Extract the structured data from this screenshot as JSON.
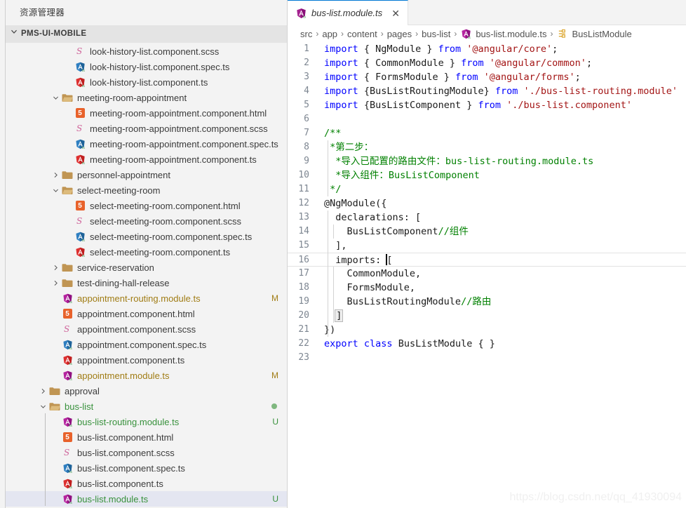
{
  "sidebar": {
    "title": "资源管理器",
    "project": {
      "name": "PMS-UI-MOBILE",
      "expanded": true
    },
    "tree": [
      {
        "depth": 4,
        "type": "file",
        "icon": "sass-icon",
        "label": "look-history-list.component.scss",
        "badge": "",
        "state": ""
      },
      {
        "depth": 4,
        "type": "file",
        "icon": "angular-spec-icon",
        "label": "look-history-list.component.spec.ts",
        "badge": "",
        "state": ""
      },
      {
        "depth": 4,
        "type": "file",
        "icon": "angular-ts-icon",
        "label": "look-history-list.component.ts",
        "badge": "",
        "state": ""
      },
      {
        "depth": 3,
        "type": "folder",
        "expanded": true,
        "icon": "folder-open-icon",
        "label": "meeting-room-appointment",
        "badge": "",
        "state": ""
      },
      {
        "depth": 4,
        "type": "file",
        "icon": "html5-icon",
        "label": "meeting-room-appointment.component.html",
        "badge": "",
        "state": ""
      },
      {
        "depth": 4,
        "type": "file",
        "icon": "sass-icon",
        "label": "meeting-room-appointment.component.scss",
        "badge": "",
        "state": ""
      },
      {
        "depth": 4,
        "type": "file",
        "icon": "angular-spec-icon",
        "label": "meeting-room-appointment.component.spec.ts",
        "badge": "",
        "state": ""
      },
      {
        "depth": 4,
        "type": "file",
        "icon": "angular-ts-icon",
        "label": "meeting-room-appointment.component.ts",
        "badge": "",
        "state": ""
      },
      {
        "depth": 3,
        "type": "folder",
        "expanded": false,
        "icon": "folder-icon",
        "label": "personnel-appointment",
        "badge": "",
        "state": ""
      },
      {
        "depth": 3,
        "type": "folder",
        "expanded": true,
        "icon": "folder-open-icon",
        "label": "select-meeting-room",
        "badge": "",
        "state": ""
      },
      {
        "depth": 4,
        "type": "file",
        "icon": "html5-icon",
        "label": "select-meeting-room.component.html",
        "badge": "",
        "state": ""
      },
      {
        "depth": 4,
        "type": "file",
        "icon": "sass-icon",
        "label": "select-meeting-room.component.scss",
        "badge": "",
        "state": ""
      },
      {
        "depth": 4,
        "type": "file",
        "icon": "angular-spec-icon",
        "label": "select-meeting-room.component.spec.ts",
        "badge": "",
        "state": ""
      },
      {
        "depth": 4,
        "type": "file",
        "icon": "angular-ts-icon",
        "label": "select-meeting-room.component.ts",
        "badge": "",
        "state": ""
      },
      {
        "depth": 3,
        "type": "folder",
        "expanded": false,
        "icon": "folder-icon",
        "label": "service-reservation",
        "badge": "",
        "state": ""
      },
      {
        "depth": 3,
        "type": "folder",
        "expanded": false,
        "icon": "folder-icon",
        "label": "test-dining-hall-release",
        "badge": "",
        "state": ""
      },
      {
        "depth": 3,
        "type": "file",
        "icon": "angular-module-icon",
        "label": "appointment-routing.module.ts",
        "badge": "M",
        "state": "mod"
      },
      {
        "depth": 3,
        "type": "file",
        "icon": "html5-icon",
        "label": "appointment.component.html",
        "badge": "",
        "state": ""
      },
      {
        "depth": 3,
        "type": "file",
        "icon": "sass-icon",
        "label": "appointment.component.scss",
        "badge": "",
        "state": ""
      },
      {
        "depth": 3,
        "type": "file",
        "icon": "angular-spec-icon",
        "label": "appointment.component.spec.ts",
        "badge": "",
        "state": ""
      },
      {
        "depth": 3,
        "type": "file",
        "icon": "angular-ts-icon",
        "label": "appointment.component.ts",
        "badge": "",
        "state": ""
      },
      {
        "depth": 3,
        "type": "file",
        "icon": "angular-module-icon",
        "label": "appointment.module.ts",
        "badge": "M",
        "state": "mod"
      },
      {
        "depth": 2,
        "type": "folder",
        "expanded": false,
        "icon": "folder-icon",
        "label": "approval",
        "badge": "",
        "state": ""
      },
      {
        "depth": 2,
        "type": "folder",
        "expanded": true,
        "icon": "folder-open-icon",
        "label": "bus-list",
        "badge": "dot",
        "state": "untracked"
      },
      {
        "depth": 3,
        "type": "file",
        "icon": "angular-module-icon",
        "label": "bus-list-routing.module.ts",
        "badge": "U",
        "state": "untracked"
      },
      {
        "depth": 3,
        "type": "file",
        "icon": "html5-icon",
        "label": "bus-list.component.html",
        "badge": "",
        "state": ""
      },
      {
        "depth": 3,
        "type": "file",
        "icon": "sass-icon",
        "label": "bus-list.component.scss",
        "badge": "",
        "state": ""
      },
      {
        "depth": 3,
        "type": "file",
        "icon": "angular-spec-icon",
        "label": "bus-list.component.spec.ts",
        "badge": "",
        "state": ""
      },
      {
        "depth": 3,
        "type": "file",
        "icon": "angular-ts-icon",
        "label": "bus-list.component.ts",
        "badge": "",
        "state": ""
      },
      {
        "depth": 3,
        "type": "file",
        "icon": "angular-module-icon",
        "label": "bus-list.module.ts",
        "badge": "U",
        "state": "untracked",
        "selected": true
      }
    ]
  },
  "editor": {
    "tab": {
      "label": "bus-list.module.ts",
      "icon": "angular-module-icon",
      "close": "✕",
      "active": true
    },
    "breadcrumb": [
      {
        "label": "src",
        "icon": ""
      },
      {
        "label": "app",
        "icon": ""
      },
      {
        "label": "content",
        "icon": ""
      },
      {
        "label": "pages",
        "icon": ""
      },
      {
        "label": "bus-list",
        "icon": ""
      },
      {
        "label": "bus-list.module.ts",
        "icon": "angular-module-icon"
      },
      {
        "label": "BusListModule",
        "icon": "class-symbol-icon"
      }
    ],
    "breadcrumb_separator": "›",
    "lines": [
      {
        "n": "1",
        "segments": [
          {
            "t": "kw",
            "v": "import"
          },
          {
            "t": "punc",
            "v": " { "
          },
          {
            "t": "ident",
            "v": "NgModule"
          },
          {
            "t": "punc",
            "v": " } "
          },
          {
            "t": "kw",
            "v": "from"
          },
          {
            "t": "punc",
            "v": " "
          },
          {
            "t": "str",
            "v": "'@angular/core'"
          },
          {
            "t": "punc",
            "v": ";"
          }
        ]
      },
      {
        "n": "2",
        "segments": [
          {
            "t": "kw",
            "v": "import"
          },
          {
            "t": "punc",
            "v": " { "
          },
          {
            "t": "ident",
            "v": "CommonModule"
          },
          {
            "t": "punc",
            "v": " } "
          },
          {
            "t": "kw",
            "v": "from"
          },
          {
            "t": "punc",
            "v": " "
          },
          {
            "t": "str",
            "v": "'@angular/common'"
          },
          {
            "t": "punc",
            "v": ";"
          }
        ]
      },
      {
        "n": "3",
        "segments": [
          {
            "t": "kw",
            "v": "import"
          },
          {
            "t": "punc",
            "v": " { "
          },
          {
            "t": "ident",
            "v": "FormsModule"
          },
          {
            "t": "punc",
            "v": " } "
          },
          {
            "t": "kw",
            "v": "from"
          },
          {
            "t": "punc",
            "v": " "
          },
          {
            "t": "str",
            "v": "'@angular/forms'"
          },
          {
            "t": "punc",
            "v": ";"
          }
        ]
      },
      {
        "n": "4",
        "segments": [
          {
            "t": "kw",
            "v": "import"
          },
          {
            "t": "punc",
            "v": " {"
          },
          {
            "t": "ident",
            "v": "BusListRoutingModule"
          },
          {
            "t": "punc",
            "v": "} "
          },
          {
            "t": "kw",
            "v": "from"
          },
          {
            "t": "punc",
            "v": " "
          },
          {
            "t": "str",
            "v": "'./bus-list-routing.module'"
          }
        ]
      },
      {
        "n": "5",
        "segments": [
          {
            "t": "kw",
            "v": "import"
          },
          {
            "t": "punc",
            "v": " {"
          },
          {
            "t": "ident",
            "v": "BusListComponent"
          },
          {
            "t": "punc",
            "v": " } "
          },
          {
            "t": "kw",
            "v": "from"
          },
          {
            "t": "punc",
            "v": " "
          },
          {
            "t": "str",
            "v": "'./bus-list.component'"
          }
        ]
      },
      {
        "n": "6",
        "segments": []
      },
      {
        "n": "7",
        "segments": [
          {
            "t": "cmt",
            "v": "/**"
          }
        ]
      },
      {
        "n": "8",
        "segments": [
          {
            "t": "cmt",
            "v": " *第二步："
          }
        ]
      },
      {
        "n": "9",
        "segments": [
          {
            "t": "cmt",
            "v": "  *导入已配置的路由文件：bus-list-routing.module.ts"
          }
        ]
      },
      {
        "n": "10",
        "segments": [
          {
            "t": "cmt",
            "v": "  *导入组件：BusListComponent"
          }
        ]
      },
      {
        "n": "11",
        "segments": [
          {
            "t": "cmt",
            "v": " */"
          }
        ]
      },
      {
        "n": "12",
        "segments": [
          {
            "t": "deco",
            "v": "@NgModule({"
          }
        ]
      },
      {
        "n": "13",
        "segments": [
          {
            "t": "plain",
            "v": "  declarations: ["
          }
        ]
      },
      {
        "n": "14",
        "segments": [
          {
            "t": "plain",
            "v": "    BusListComponent"
          },
          {
            "t": "cmt",
            "v": "//组件"
          }
        ]
      },
      {
        "n": "15",
        "segments": [
          {
            "t": "plain",
            "v": "  ],"
          }
        ]
      },
      {
        "n": "16",
        "segments": [
          {
            "t": "plain",
            "v": "  imports: "
          },
          {
            "t": "cursor",
            "v": "["
          }
        ],
        "current": true
      },
      {
        "n": "17",
        "segments": [
          {
            "t": "plain",
            "v": "    CommonModule,"
          }
        ]
      },
      {
        "n": "18",
        "segments": [
          {
            "t": "plain",
            "v": "    FormsModule,"
          }
        ]
      },
      {
        "n": "19",
        "segments": [
          {
            "t": "plain",
            "v": "    BusListRoutingModule"
          },
          {
            "t": "cmt",
            "v": "//路由"
          }
        ]
      },
      {
        "n": "20",
        "segments": [
          {
            "t": "plain",
            "v": "  "
          },
          {
            "t": "bracket",
            "v": "]"
          }
        ]
      },
      {
        "n": "21",
        "segments": [
          {
            "t": "plain",
            "v": "})"
          }
        ]
      },
      {
        "n": "22",
        "segments": [
          {
            "t": "kw",
            "v": "export"
          },
          {
            "t": "punc",
            "v": " "
          },
          {
            "t": "kw",
            "v": "class"
          },
          {
            "t": "punc",
            "v": " "
          },
          {
            "t": "ident",
            "v": "BusListModule"
          },
          {
            "t": "punc",
            "v": " { }"
          }
        ]
      },
      {
        "n": "23",
        "segments": []
      }
    ]
  },
  "watermark": "https://blog.csdn.net/qq_41930094",
  "colors": {
    "accent": "#0078d4",
    "modified": "#a07c14",
    "untracked": "#38913c",
    "selection": "#e4e6f1",
    "sidebar_bg": "#f3f3f3",
    "keyword": "#0000ff",
    "string": "#a31515",
    "comment": "#008000"
  }
}
